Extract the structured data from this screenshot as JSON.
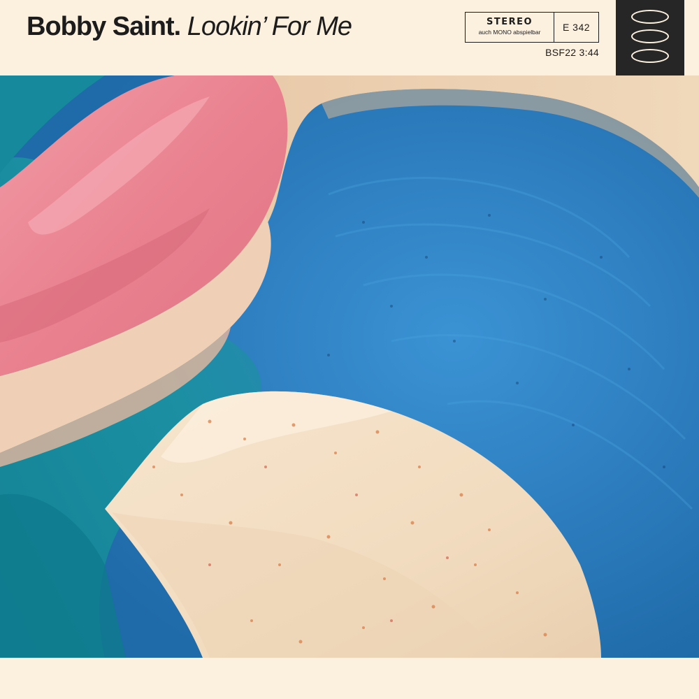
{
  "header": {
    "artist": "Bobby Saint.",
    "song_title": "Lookin’ For Me",
    "stereo_label": "STEREO",
    "stereo_sublabel": "auch MONO abspielbar",
    "catalog_number": "E 342",
    "code_and_duration": "BSF22 3:44"
  },
  "logo": {
    "icon": "three-rings-logo-icon"
  },
  "artwork": {
    "description_icon": "ice-cream-swirl-artwork"
  },
  "colors": {
    "background": "#fcf0df",
    "text": "#1c1c1c",
    "logo_panel": "#262626",
    "blue": "#2f7fbe",
    "teal": "#1a8a9a",
    "pink": "#ea7f8f",
    "cream": "#f3dfc4"
  }
}
